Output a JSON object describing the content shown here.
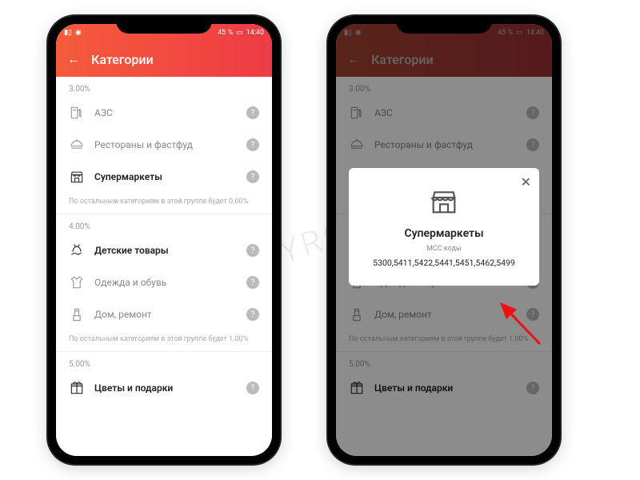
{
  "status": {
    "battery": "45 %",
    "time": "14:40"
  },
  "appbar": {
    "title": "Категории"
  },
  "groups": [
    {
      "pct": "3.00%",
      "items": [
        {
          "icon": "gas",
          "label": "АЗС",
          "bold": false
        },
        {
          "icon": "food",
          "label": "Рестораны и фастфуд",
          "bold": false
        },
        {
          "icon": "store",
          "label": "Супермаркеты",
          "bold": true
        }
      ],
      "note": "По остальным категориям в этой группе будет 0.00%"
    },
    {
      "pct": "4.00%",
      "items": [
        {
          "icon": "toy",
          "label": "Детские товары",
          "bold": true
        },
        {
          "icon": "shirt",
          "label": "Одежда и обувь",
          "bold": false
        },
        {
          "icon": "repair",
          "label": "Дом, ремонт",
          "bold": false
        }
      ],
      "note": "По остальным категориям в этой группе будет 1.00%"
    },
    {
      "pct": "5.00%",
      "items": [
        {
          "icon": "gift",
          "label": "Цветы и подарки",
          "bold": true
        }
      ],
      "note": ""
    }
  ],
  "modal": {
    "title": "Супермаркеты",
    "sub": "MCC коды",
    "codes": "5300,5411,5422,5441,5451,5462,5499"
  },
  "watermark": "WWW.MYROUBLE.RU"
}
